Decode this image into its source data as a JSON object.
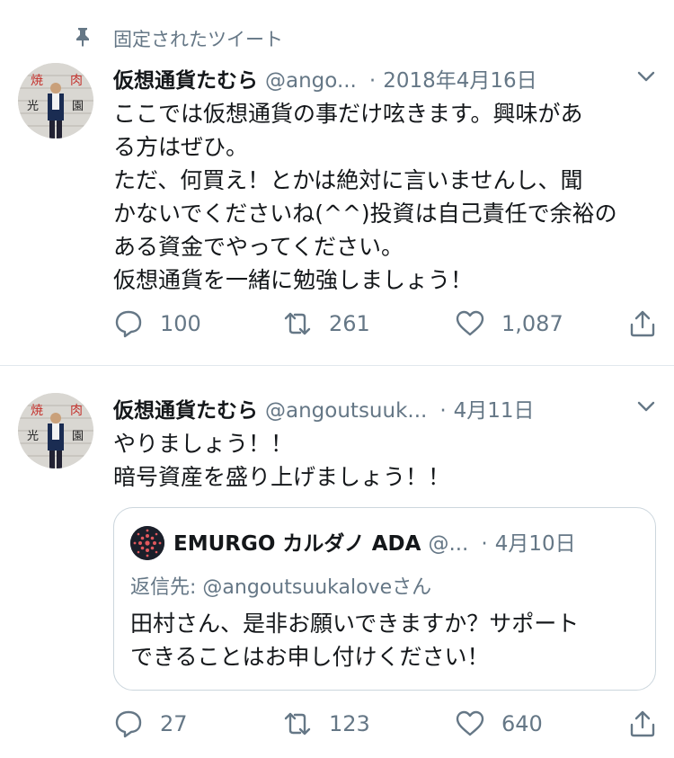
{
  "pinned": {
    "label": "固定されたツイート"
  },
  "colors": {
    "secondary": "#657786",
    "text": "#14171a",
    "border": "#e1e8ed"
  },
  "tweets": [
    {
      "name": "仮想通貨たむら",
      "handle": "@ango...",
      "separator": "·",
      "date": "2018年4月16日",
      "lines": [
        "ここでは仮想通貨の事だけ呟きます。興味があ",
        "る方はぜひ。",
        "ただ、何買え！とかは絶対に言いませんし、聞",
        "かないでくださいね(^^)投資は自己責任で余裕の",
        "ある資金でやってください。",
        "仮想通貨を一緒に勉強しましょう！"
      ],
      "counts": {
        "replies": "100",
        "retweets": "261",
        "likes": "1,087"
      },
      "avatar_sign": [
        "焼",
        "肉",
        "光",
        "園"
      ]
    },
    {
      "name": "仮想通貨たむら",
      "handle": "@angoutsuuk...",
      "separator": "·",
      "date": "4月11日",
      "lines": [
        "やりましょう！！",
        "暗号資産を盛り上げましょう！！"
      ],
      "quote": {
        "name": "EMURGO カルダノ ADA",
        "handle": "@...",
        "separator": "·",
        "date": "4月10日",
        "reply_to": "返信先: @angoutsuukaloveさん",
        "lines": [
          "田村さん、是非お願いできますか？サポート",
          "できることはお申し付けください！"
        ]
      },
      "counts": {
        "replies": "27",
        "retweets": "123",
        "likes": "640"
      },
      "avatar_sign": [
        "焼",
        "肉",
        "光",
        "園"
      ]
    }
  ],
  "icons": [
    "pin-icon",
    "chevron-down-icon",
    "reply-icon",
    "retweet-icon",
    "like-icon",
    "share-icon"
  ]
}
